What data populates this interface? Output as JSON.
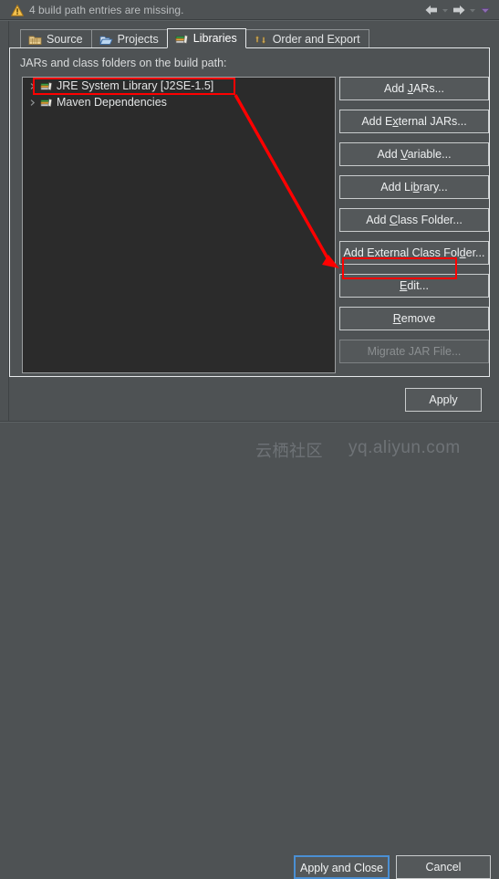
{
  "banner": {
    "icon": "warning-triangle-icon",
    "message": "4 build path entries are missing.",
    "nav": {
      "back_icon": "back-arrow-icon",
      "back_menu_icon": "chevron-down-icon",
      "forward_icon": "forward-arrow-icon",
      "forward_menu_icon": "chevron-down-icon",
      "overflow_icon": "chevron-down-icon"
    }
  },
  "tabs": [
    {
      "label": "Source",
      "icon": "source-folder-icon",
      "active": false
    },
    {
      "label": "Projects",
      "icon": "projects-folder-icon",
      "active": false
    },
    {
      "label": "Libraries",
      "icon": "libraries-books-icon",
      "active": true
    },
    {
      "label": "Order and Export",
      "icon": "order-export-arrows-icon",
      "active": false
    }
  ],
  "panel": {
    "label": "JARs and class folders on the build path:"
  },
  "tree": {
    "items": [
      {
        "label": "JRE System Library [J2SE-1.5]",
        "icon": "library-books-icon",
        "twisty": "chevron-right-icon",
        "highlighted": true
      },
      {
        "label": "Maven Dependencies",
        "icon": "library-books-icon",
        "twisty": "chevron-right-icon",
        "highlighted": false
      }
    ]
  },
  "side_buttons": [
    {
      "label": "Add JARs...",
      "mnemonic": "J",
      "enabled": true,
      "highlighted": false
    },
    {
      "label": "Add External JARs...",
      "mnemonic": "x",
      "enabled": true,
      "highlighted": false
    },
    {
      "label": "Add Variable...",
      "mnemonic": "V",
      "enabled": true,
      "highlighted": false
    },
    {
      "label": "Add Library...",
      "mnemonic": "b",
      "enabled": true,
      "highlighted": false
    },
    {
      "label": "Add Class Folder...",
      "mnemonic": "C",
      "enabled": true,
      "highlighted": false
    },
    {
      "label": "Add External Class Folder...",
      "mnemonic": "d",
      "enabled": true,
      "highlighted": false
    },
    {
      "label": "Edit...",
      "mnemonic": "E",
      "enabled": true,
      "highlighted": true
    },
    {
      "label": "Remove",
      "mnemonic": "R",
      "enabled": true,
      "highlighted": false
    },
    {
      "label": "Migrate JAR File...",
      "mnemonic": "",
      "enabled": false,
      "highlighted": false
    }
  ],
  "apply_button": {
    "label": "Apply",
    "mnemonic": "A"
  },
  "footer": {
    "apply_and_close": {
      "label": "Apply and Close",
      "focused": true
    },
    "cancel": {
      "label": "Cancel"
    }
  },
  "annotations": {
    "color": "#ff0000",
    "arrow": "red-arrow-from-jre-item-to-edit-button"
  },
  "watermark": {
    "cn": "云栖社区",
    "en": "yq.aliyun.com"
  },
  "colors": {
    "dialog_bg": "#4e5254",
    "tree_bg": "#2b2b2b",
    "text": "#e2e4e5",
    "accent_focus": "#4a8fd4",
    "annotation": "#ff0000",
    "warning": "#f0b429"
  }
}
